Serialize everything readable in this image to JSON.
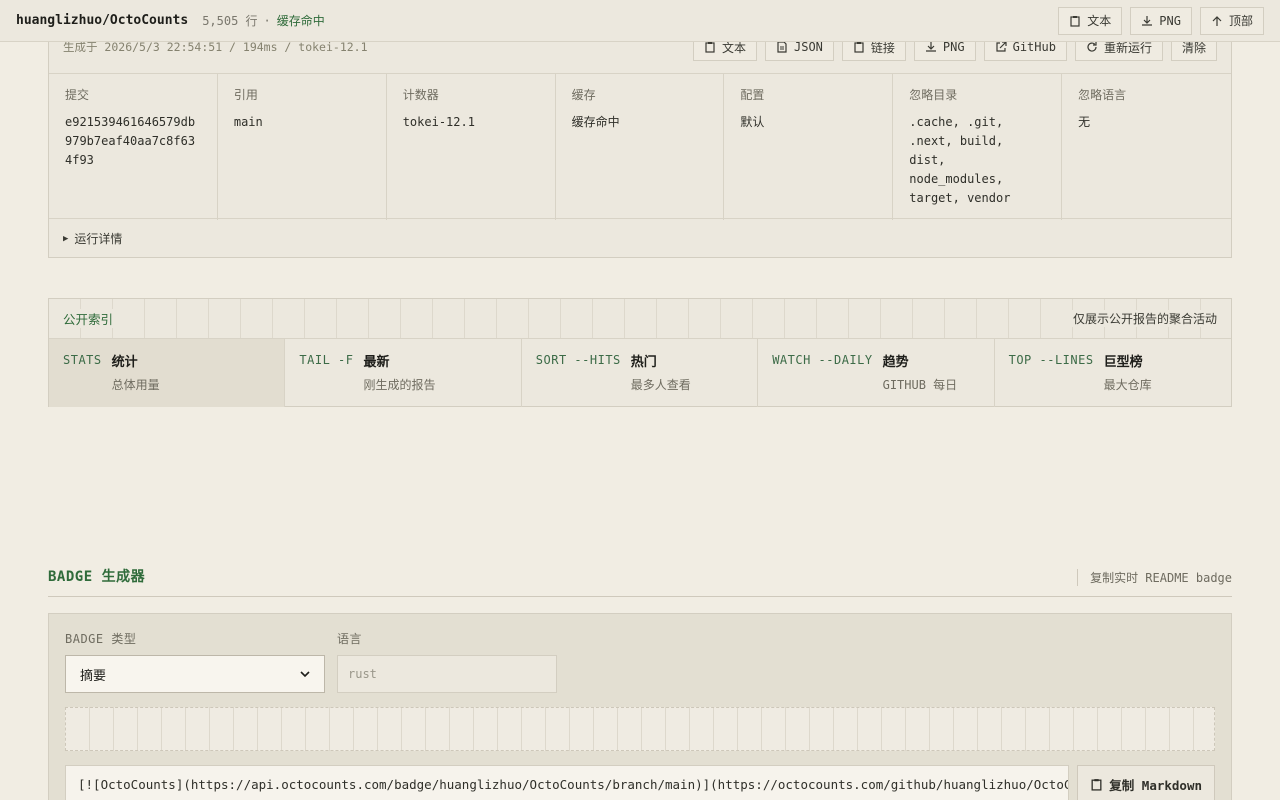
{
  "topbar": {
    "repo": "huanglizhuo/OctoCounts",
    "lines": "5,505 行",
    "separator": "·",
    "cache_status": "缓存命中",
    "actions": [
      {
        "label": "文本",
        "icon": "clipboard-icon"
      },
      {
        "label": "PNG",
        "icon": "download-icon"
      },
      {
        "label": "顶部",
        "icon": "arrow-up-icon"
      }
    ]
  },
  "run": {
    "generated": "生成于 2026/5/3 22:54:51 / 194ms / tokei-12.1",
    "actions": [
      {
        "label": "文本",
        "icon": "clipboard-icon"
      },
      {
        "label": "JSON",
        "icon": "file-icon"
      },
      {
        "label": "链接",
        "icon": "clipboard-icon"
      },
      {
        "label": "PNG",
        "icon": "download-icon"
      },
      {
        "label": "GitHub",
        "icon": "external-link-icon"
      },
      {
        "label": "重新运行",
        "icon": "refresh-icon"
      },
      {
        "label": "清除",
        "icon": ""
      }
    ],
    "meta": [
      {
        "key": "提交",
        "value": "e921539461646579db979b7eaf40aa7c8f634f93"
      },
      {
        "key": "引用",
        "value": "main"
      },
      {
        "key": "计数器",
        "value": "tokei-12.1"
      },
      {
        "key": "缓存",
        "value": "缓存命中"
      },
      {
        "key": "配置",
        "value": "默认"
      },
      {
        "key": "忽略目录",
        "value": ".cache, .git, .next, build, dist, node_modules, target, vendor"
      },
      {
        "key": "忽略语言",
        "value": "无"
      }
    ],
    "details_label": "运行详情",
    "details_marker": "▶"
  },
  "index": {
    "title": "公开索引",
    "note": "仅展示公开报告的聚合活动",
    "tabs": [
      {
        "cmd": "STATS",
        "label": "统计",
        "sub": "总体用量",
        "active": true
      },
      {
        "cmd": "TAIL -F",
        "label": "最新",
        "sub": "刚生成的报告",
        "active": false
      },
      {
        "cmd": "SORT --HITS",
        "label": "热门",
        "sub": "最多人查看",
        "active": false
      },
      {
        "cmd": "WATCH --DAILY",
        "label": "趋势",
        "sub": "GITHUB 每日",
        "active": false
      },
      {
        "cmd": "TOP --LINES",
        "label": "巨型榜",
        "sub": "最大仓库",
        "active": false
      }
    ]
  },
  "badge": {
    "heading": "BADGE 生成器",
    "copy_hint": "复制实时 README badge",
    "type_label": "BADGE 类型",
    "type_value": "摘要",
    "lang_label": "语言",
    "lang_placeholder": "rust",
    "markdown": "[![OctoCounts](https://api.octocounts.com/badge/huanglizhuo/OctoCounts/branch/main)](https://octocounts.com/github/huanglizhuo/OctoCounts/",
    "copy_button": "复制 Markdown"
  },
  "colors": {
    "background": "#f1ede3",
    "accent_green": "#2f6b3a",
    "border": "#d3cec1"
  }
}
